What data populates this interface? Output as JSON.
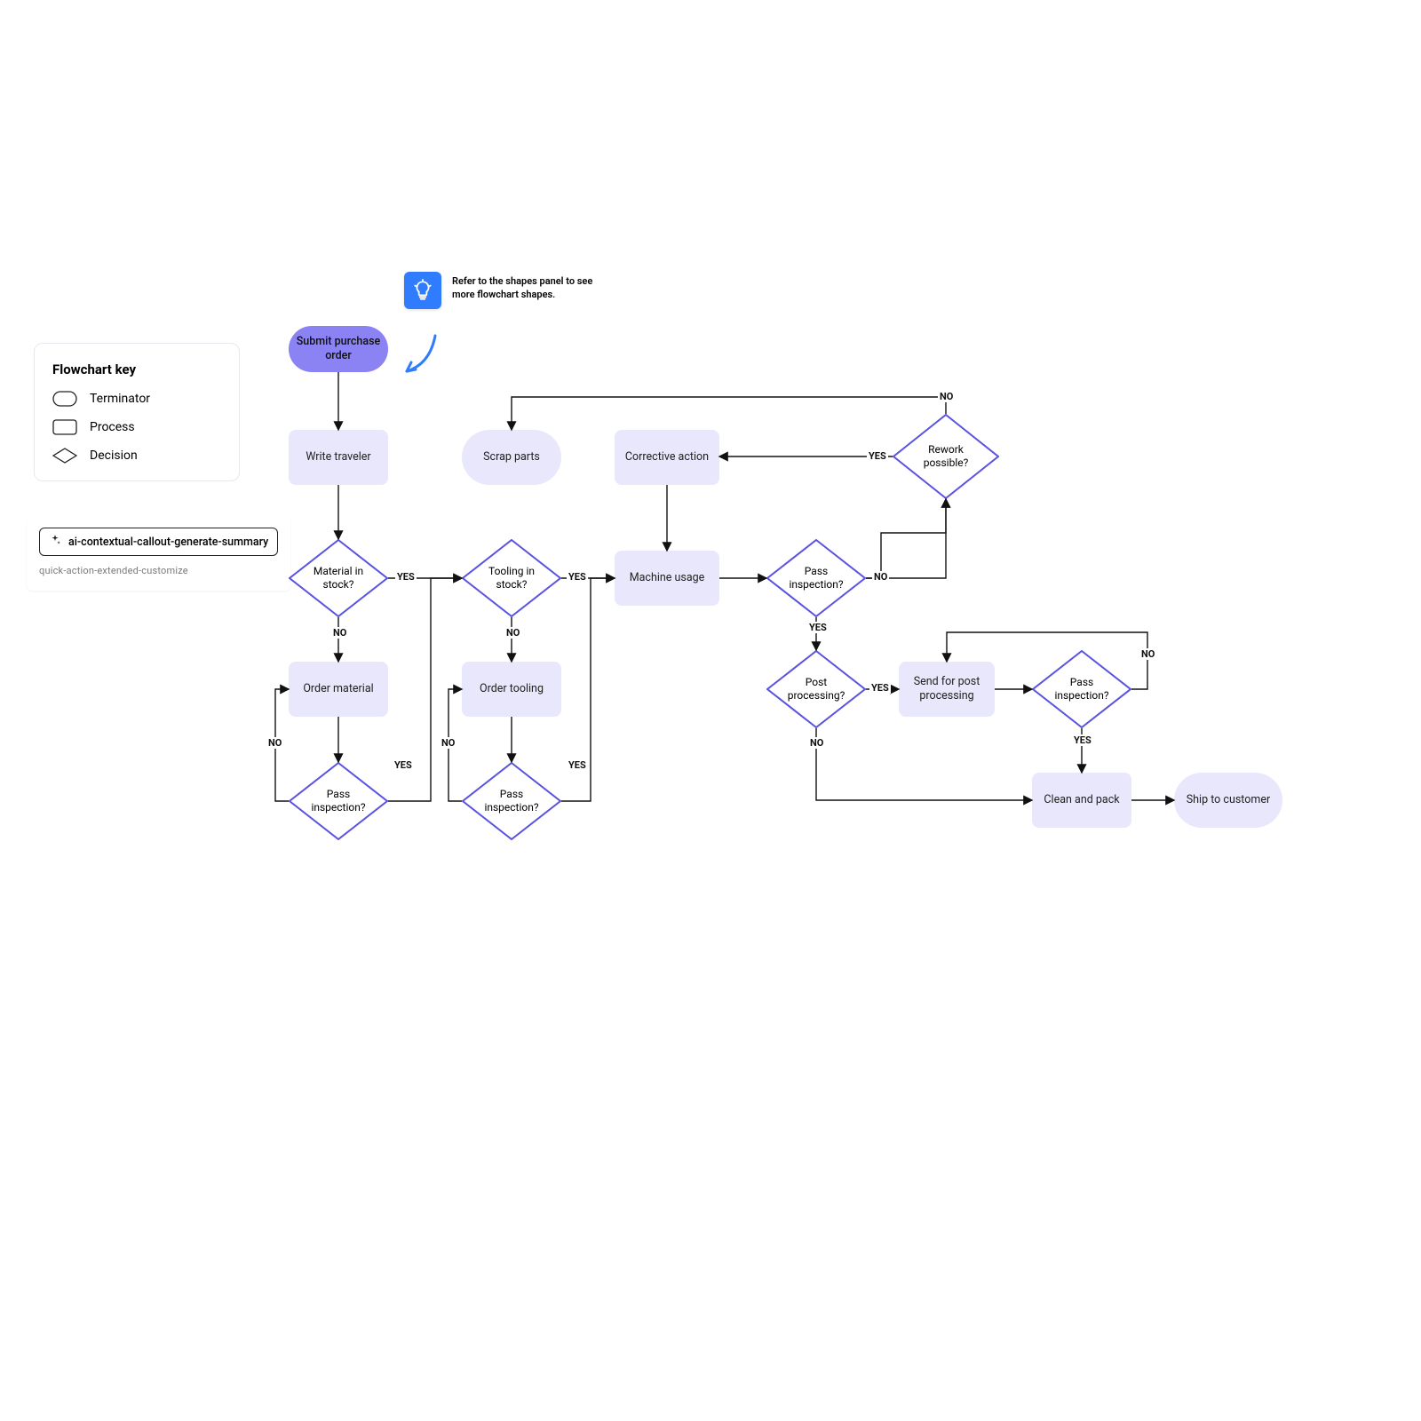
{
  "legend": {
    "title": "Flowchart key",
    "items": [
      {
        "label": "Terminator"
      },
      {
        "label": "Process"
      },
      {
        "label": "Decision"
      }
    ]
  },
  "tip": {
    "text": "Refer to the shapes panel to see more flowchart shapes."
  },
  "ai": {
    "chip": "ai-contextual-callout-generate-summary",
    "sub": "quick-action-extended-customize"
  },
  "nodes": {
    "start": "Submit purchase order",
    "writeTraveler": "Write traveler",
    "scrapParts": "Scrap parts",
    "correctiveAction": "Corrective action",
    "reworkPossible": "Rework possible?",
    "materialStock": "Material in stock?",
    "toolingStock": "Tooling in stock?",
    "machineUsage": "Machine usage",
    "passInspection1": "Pass inspection?",
    "orderMaterial": "Order material",
    "orderTooling": "Order tooling",
    "passInspectionMat": "Pass inspection?",
    "passInspectionTool": "Pass inspection?",
    "postProcessing": "Post processing?",
    "sendPost": "Send for post processing",
    "passInspection2": "Pass inspection?",
    "cleanPack": "Clean and pack",
    "shipCustomer": "Ship to customer"
  },
  "edges": {
    "yes": "YES",
    "no": "NO"
  },
  "colors": {
    "accent": "#5a52e0",
    "fill": "#e8e7fb",
    "startFill": "#8b83f4"
  }
}
